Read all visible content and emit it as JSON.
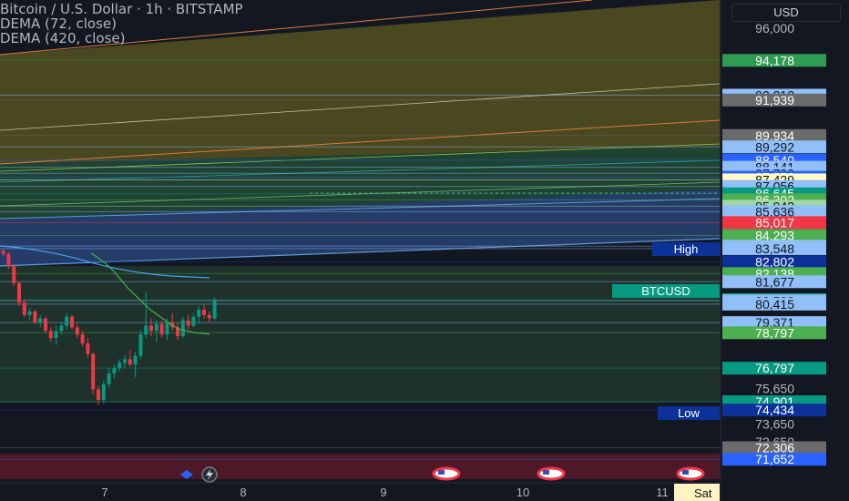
{
  "legend": {
    "symbol_line": "Bitcoin / U.S. Dollar · 1h · BITSTAMP",
    "dema72": "DEMA (72, close)",
    "dema420": "DEMA (420, close)"
  },
  "currency_button": "USD",
  "price_scale": {
    "min": 71200,
    "max": 96300,
    "plain_ticks": [
      "96,000",
      "75,650",
      "73,650",
      "72,650"
    ],
    "labels": [
      {
        "value": 94178,
        "text": "94,178",
        "color": "#2e9c52"
      },
      {
        "value": 92212,
        "text": "92,212",
        "color": "#90bff9"
      },
      {
        "value": 91939,
        "text": "91,939",
        "color": "#6b6b6b"
      },
      {
        "value": 89934,
        "text": "89,934",
        "color": "#6b6b6b"
      },
      {
        "value": 89292,
        "text": "89,292",
        "color": "#90bff9"
      },
      {
        "value": 88540,
        "text": "88,540",
        "color": "#2962ff"
      },
      {
        "value": 88141,
        "text": "88,141",
        "color": "#90bff9"
      },
      {
        "value": 87799,
        "text": "87,799",
        "color": "#90bff9"
      },
      {
        "value": 87578,
        "text": "87,578",
        "color": "#2962ff"
      },
      {
        "value": 87429,
        "text": "87,429",
        "color": "#fff9c4"
      },
      {
        "value": 87056,
        "text": "87,056",
        "color": "#90bff9"
      },
      {
        "value": 86645,
        "text": "86,645",
        "color": "#089981"
      },
      {
        "value": 86302,
        "text": "86,302",
        "color": "#4caf50"
      },
      {
        "value": 85942,
        "text": "85,942",
        "color": "#a5d6a7"
      },
      {
        "value": 85636,
        "text": "85,636",
        "color": "#90bff9"
      },
      {
        "value": 85017,
        "text": "85,017",
        "color": "#f23645"
      },
      {
        "value": 84293,
        "text": "84,293",
        "color": "#4caf50"
      },
      {
        "value": 83683,
        "text": "83,683",
        "color": "#90bff9"
      },
      {
        "value": 83548,
        "text": "83,548",
        "color": "#90bff9"
      },
      {
        "value": 82802,
        "text": "82,802",
        "color": "#0c3299"
      },
      {
        "value": 82138,
        "text": "82,138",
        "color": "#4caf50"
      },
      {
        "value": 81677,
        "text": "81,677",
        "color": "#90bff9"
      },
      {
        "value": 80664,
        "text": "80,664",
        "color": "#089981"
      },
      {
        "value": 80599,
        "text": "80,599",
        "color": "#90bff9"
      },
      {
        "value": 80415,
        "text": "80,415",
        "color": "#90bff9"
      },
      {
        "value": 79371,
        "text": "79,371",
        "color": "#90bff9"
      },
      {
        "value": 78797,
        "text": "78,797",
        "color": "#4caf50"
      },
      {
        "value": 76797,
        "text": "76,797",
        "color": "#089981"
      },
      {
        "value": 74901,
        "text": "74,901",
        "color": "#089981"
      },
      {
        "value": 74434,
        "text": "74,434",
        "color": "#0c3299"
      },
      {
        "value": 72306,
        "text": "72,306",
        "color": "#6b6b6b"
      },
      {
        "value": 71652,
        "text": "71,652",
        "color": "#2962ff"
      }
    ],
    "high_label": "High",
    "low_label": "Low",
    "last_price_label": "BTCUSD"
  },
  "time_axis": {
    "labels": [
      "7",
      "8",
      "9",
      "10",
      "11"
    ],
    "highlight_label": "Sat"
  },
  "colors": {
    "up": "#089981",
    "down": "#f23645",
    "dema72": "#4caf50",
    "dema420": "#42a5f5",
    "background": "#131722"
  },
  "chart_data": {
    "type": "candlestick",
    "x": [
      "7",
      "8",
      "9",
      "10",
      "11"
    ],
    "ylim": [
      71200,
      96300
    ],
    "candles": [
      {
        "o": 83700,
        "h": 83760,
        "l": 83500,
        "c": 83560
      },
      {
        "o": 83560,
        "h": 83700,
        "l": 83300,
        "c": 83420
      },
      {
        "o": 83420,
        "h": 83560,
        "l": 83100,
        "c": 83250
      },
      {
        "o": 83250,
        "h": 83350,
        "l": 82400,
        "c": 82550
      },
      {
        "o": 82550,
        "h": 82700,
        "l": 81400,
        "c": 81600
      },
      {
        "o": 81600,
        "h": 81700,
        "l": 80300,
        "c": 80500
      },
      {
        "o": 80500,
        "h": 80700,
        "l": 79700,
        "c": 79800
      },
      {
        "o": 79800,
        "h": 80200,
        "l": 79500,
        "c": 80000
      },
      {
        "o": 80000,
        "h": 80100,
        "l": 79300,
        "c": 79400
      },
      {
        "o": 79400,
        "h": 79800,
        "l": 79100,
        "c": 79600
      },
      {
        "o": 79600,
        "h": 79700,
        "l": 78800,
        "c": 78900
      },
      {
        "o": 78900,
        "h": 79100,
        "l": 78300,
        "c": 78500
      },
      {
        "o": 78500,
        "h": 79200,
        "l": 78100,
        "c": 78900
      },
      {
        "o": 78900,
        "h": 79400,
        "l": 78700,
        "c": 79200
      },
      {
        "o": 79200,
        "h": 79900,
        "l": 79000,
        "c": 79700
      },
      {
        "o": 79700,
        "h": 79800,
        "l": 79000,
        "c": 79100
      },
      {
        "o": 79100,
        "h": 79300,
        "l": 78500,
        "c": 78700
      },
      {
        "o": 78700,
        "h": 78900,
        "l": 78000,
        "c": 78200
      },
      {
        "o": 78200,
        "h": 78500,
        "l": 77400,
        "c": 77600
      },
      {
        "o": 77600,
        "h": 77700,
        "l": 75300,
        "c": 75600
      },
      {
        "o": 75600,
        "h": 75800,
        "l": 74700,
        "c": 75000
      },
      {
        "o": 75000,
        "h": 76100,
        "l": 74800,
        "c": 75900
      },
      {
        "o": 75900,
        "h": 76800,
        "l": 75700,
        "c": 76500
      },
      {
        "o": 76500,
        "h": 77000,
        "l": 76200,
        "c": 76800
      },
      {
        "o": 76800,
        "h": 77300,
        "l": 76600,
        "c": 77100
      },
      {
        "o": 77100,
        "h": 77500,
        "l": 76800,
        "c": 77300
      },
      {
        "o": 77300,
        "h": 77800,
        "l": 76900,
        "c": 77000
      },
      {
        "o": 77000,
        "h": 77700,
        "l": 76300,
        "c": 77500
      },
      {
        "o": 77500,
        "h": 78900,
        "l": 77300,
        "c": 78700
      },
      {
        "o": 78700,
        "h": 81100,
        "l": 78500,
        "c": 79200
      },
      {
        "o": 79200,
        "h": 79600,
        "l": 78600,
        "c": 78900
      },
      {
        "o": 78900,
        "h": 79500,
        "l": 78300,
        "c": 79300
      },
      {
        "o": 79300,
        "h": 79500,
        "l": 78500,
        "c": 78700
      },
      {
        "o": 78700,
        "h": 79600,
        "l": 78400,
        "c": 79400
      },
      {
        "o": 79400,
        "h": 79900,
        "l": 78900,
        "c": 79100
      },
      {
        "o": 79100,
        "h": 79400,
        "l": 78400,
        "c": 78600
      },
      {
        "o": 78600,
        "h": 79700,
        "l": 78500,
        "c": 79500
      },
      {
        "o": 79500,
        "h": 79800,
        "l": 79000,
        "c": 79200
      },
      {
        "o": 79200,
        "h": 79900,
        "l": 79100,
        "c": 79700
      },
      {
        "o": 79700,
        "h": 80300,
        "l": 79300,
        "c": 80100
      },
      {
        "o": 80100,
        "h": 80400,
        "l": 79600,
        "c": 79800
      },
      {
        "o": 79800,
        "h": 80000,
        "l": 79400,
        "c": 79600
      },
      {
        "o": 79600,
        "h": 80800,
        "l": 79500,
        "c": 80664
      }
    ],
    "series": [
      {
        "name": "DEMA (72, close)",
        "values": [
          83300,
          83000,
          82700,
          82300,
          81800,
          81300,
          80900,
          80500,
          80100,
          79800,
          79500,
          79200,
          79000,
          78900,
          78800,
          78760,
          78720
        ]
      },
      {
        "name": "DEMA (420, close)",
        "values": [
          83700,
          83600,
          83450,
          83250,
          83000,
          82700,
          82450,
          82250,
          82100,
          82000,
          81950,
          81900
        ]
      }
    ]
  }
}
